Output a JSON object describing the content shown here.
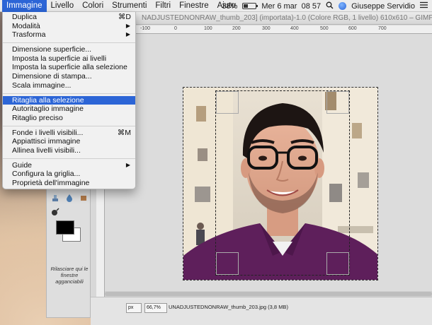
{
  "menubar": {
    "app_menus": [
      "Immagine",
      "Livello",
      "Colori",
      "Strumenti",
      "Filtri",
      "Finestre",
      "Aiuto"
    ],
    "active_menu": "Immagine",
    "battery_percent": "38%",
    "battery_level": 0.38,
    "datetime": "Mer 6 mar  08 57",
    "search_icon": "magnifier-icon",
    "user_name": "Giuseppe Servidio",
    "list_icon": "menu-lines-icon"
  },
  "window": {
    "title": "NADJUSTEDNONRAW_thumb_203] (importata)-1.0 (Colore RGB, 1 livello) 610x610 – GIMP"
  },
  "ruler": {
    "ticks": [
      "-100",
      "0",
      "100",
      "200",
      "300",
      "400",
      "500",
      "600",
      "700"
    ]
  },
  "statusbar": {
    "unit": "px",
    "zoom": "66,7%",
    "file_info": "UNADJUSTEDNONRAW_thumb_203.jpg (3,8 MB)"
  },
  "dock": {
    "note": "Rilasciare qui le finestre agganciabili"
  },
  "image_menu": {
    "items": [
      {
        "label": "Duplica",
        "shortcut": "⌘D",
        "submenu": false,
        "highlight": false
      },
      {
        "label": "Modalità",
        "shortcut": "",
        "submenu": true,
        "highlight": false
      },
      {
        "label": "Trasforma",
        "shortcut": "",
        "submenu": true,
        "highlight": false
      },
      {
        "label": "Dimensione superficie...",
        "shortcut": "",
        "submenu": false,
        "highlight": false
      },
      {
        "label": "Imposta la superficie ai livelli",
        "shortcut": "",
        "submenu": false,
        "highlight": false
      },
      {
        "label": "Imposta la superficie alla selezione",
        "shortcut": "",
        "submenu": false,
        "highlight": false
      },
      {
        "label": "Dimensione di stampa...",
        "shortcut": "",
        "submenu": false,
        "highlight": false
      },
      {
        "label": "Scala immagine...",
        "shortcut": "",
        "submenu": false,
        "highlight": false
      },
      {
        "label": "Ritaglia alla selezione",
        "shortcut": "",
        "submenu": false,
        "highlight": true
      },
      {
        "label": "Autoritaglio immagine",
        "shortcut": "",
        "submenu": false,
        "highlight": false
      },
      {
        "label": "Ritaglio preciso",
        "shortcut": "",
        "submenu": false,
        "highlight": false
      },
      {
        "label": "Fonde i livelli visibili...",
        "shortcut": "⌘M",
        "submenu": false,
        "highlight": false
      },
      {
        "label": "Appiattisci immagine",
        "shortcut": "",
        "submenu": false,
        "highlight": false
      },
      {
        "label": "Allinea livelli visibili...",
        "shortcut": "",
        "submenu": false,
        "highlight": false
      },
      {
        "label": "Guide",
        "shortcut": "",
        "submenu": true,
        "highlight": false
      },
      {
        "label": "Configura la griglia...",
        "shortcut": "",
        "submenu": false,
        "highlight": false
      },
      {
        "label": "Proprietà dell'immagine",
        "shortcut": "",
        "submenu": false,
        "highlight": false
      }
    ]
  },
  "colors": {
    "highlight": "#2c65d6",
    "shirt": "#5e1f5b",
    "foreground": "#000000",
    "background": "#ffffff"
  }
}
